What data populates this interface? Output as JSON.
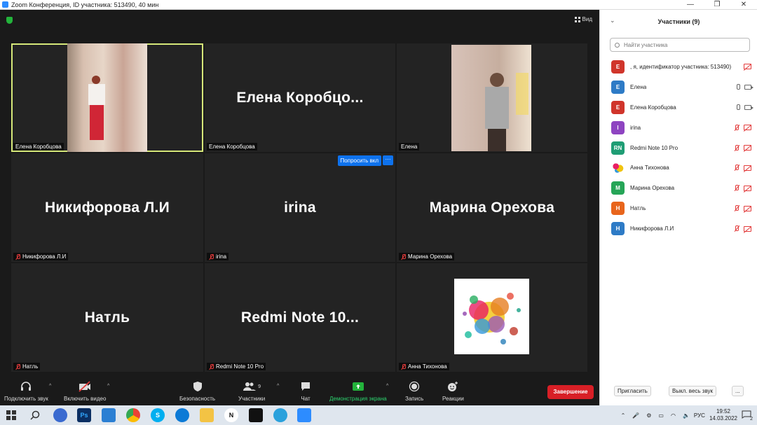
{
  "window": {
    "title": "Zoom Конференция, ID участника: 513490, 40 мин",
    "controls": [
      "—",
      "❐",
      "✕"
    ]
  },
  "top": {
    "view_label": "Вид"
  },
  "tiles": [
    {
      "big_name": "",
      "label": "Елена Коробцова",
      "muted": false,
      "has_video": true,
      "active": true
    },
    {
      "big_name": "Елена  Коробцо...",
      "label": "Елена Коробцова",
      "muted": false,
      "has_video": false
    },
    {
      "big_name": "",
      "label": "Елена",
      "muted": false,
      "has_video": true
    },
    {
      "big_name": "Никифорова Л.И",
      "label": "Никифорова Л.И",
      "muted": true,
      "has_video": false
    },
    {
      "big_name": "irina",
      "label": "irina",
      "muted": true,
      "has_video": false,
      "ask_button": "Попросить вкл",
      "more_button": "···"
    },
    {
      "big_name": "Марина Орехова",
      "label": "Марина Орехова",
      "muted": true,
      "has_video": false
    },
    {
      "big_name": "Натль",
      "label": "Натль",
      "muted": true,
      "has_video": false
    },
    {
      "big_name": "Redmi Note 10...",
      "label": "Redmi Note 10 Pro",
      "muted": true,
      "has_video": false
    },
    {
      "big_name": "",
      "label": "Анна Тихонова",
      "muted": true,
      "has_video": true
    }
  ],
  "toolbar": {
    "audio": "Подключить звук",
    "video": "Включить видео",
    "security": "Безопасность",
    "participants": "Участники",
    "participants_count": "9",
    "chat": "Чат",
    "share": "Демонстрация экрана",
    "record": "Запись",
    "reactions": "Реакции",
    "end": "Завершение",
    "caret": "^"
  },
  "panel": {
    "title": "Участники (9)",
    "search_placeholder": "Найти участника",
    "participants": [
      {
        "initials": "Е",
        "name": ", я, идентификатор участника: 513490)",
        "color": "#d0352b",
        "mic": "off",
        "cam": "off"
      },
      {
        "initials": "Е",
        "name": "Елена",
        "color": "#2e7bc6",
        "mic": "on",
        "cam": "on"
      },
      {
        "initials": "Е",
        "name": "Елена Коробцова",
        "color": "#d0352b",
        "mic": "on",
        "cam": "on"
      },
      {
        "initials": "I",
        "name": "irina",
        "color": "#8e44c1",
        "mic": "off",
        "cam": "off"
      },
      {
        "initials": "RN",
        "name": "Redmi Note 10 Pro",
        "color": "#1f9d74",
        "mic": "off",
        "cam": "off"
      },
      {
        "initials": "",
        "name": "Анна Тихонова",
        "color": "#f5a623",
        "mic": "off",
        "cam": "off",
        "image_avatar": true
      },
      {
        "initials": "М",
        "name": "Марина Орехова",
        "color": "#26a557",
        "mic": "off",
        "cam": "off"
      },
      {
        "initials": "Н",
        "name": "Натль",
        "color": "#e8651c",
        "mic": "off",
        "cam": "off"
      },
      {
        "initials": "Н",
        "name": "Никифорова Л.И",
        "color": "#2e7bc6",
        "mic": "off",
        "cam": "off"
      }
    ],
    "invite": "Пригласить",
    "mute_all": "Выкл. весь звук",
    "more": "..."
  },
  "taskbar": {
    "lang": "РУС",
    "time": "19:52",
    "date": "14.03.2022",
    "notifications": "2"
  }
}
